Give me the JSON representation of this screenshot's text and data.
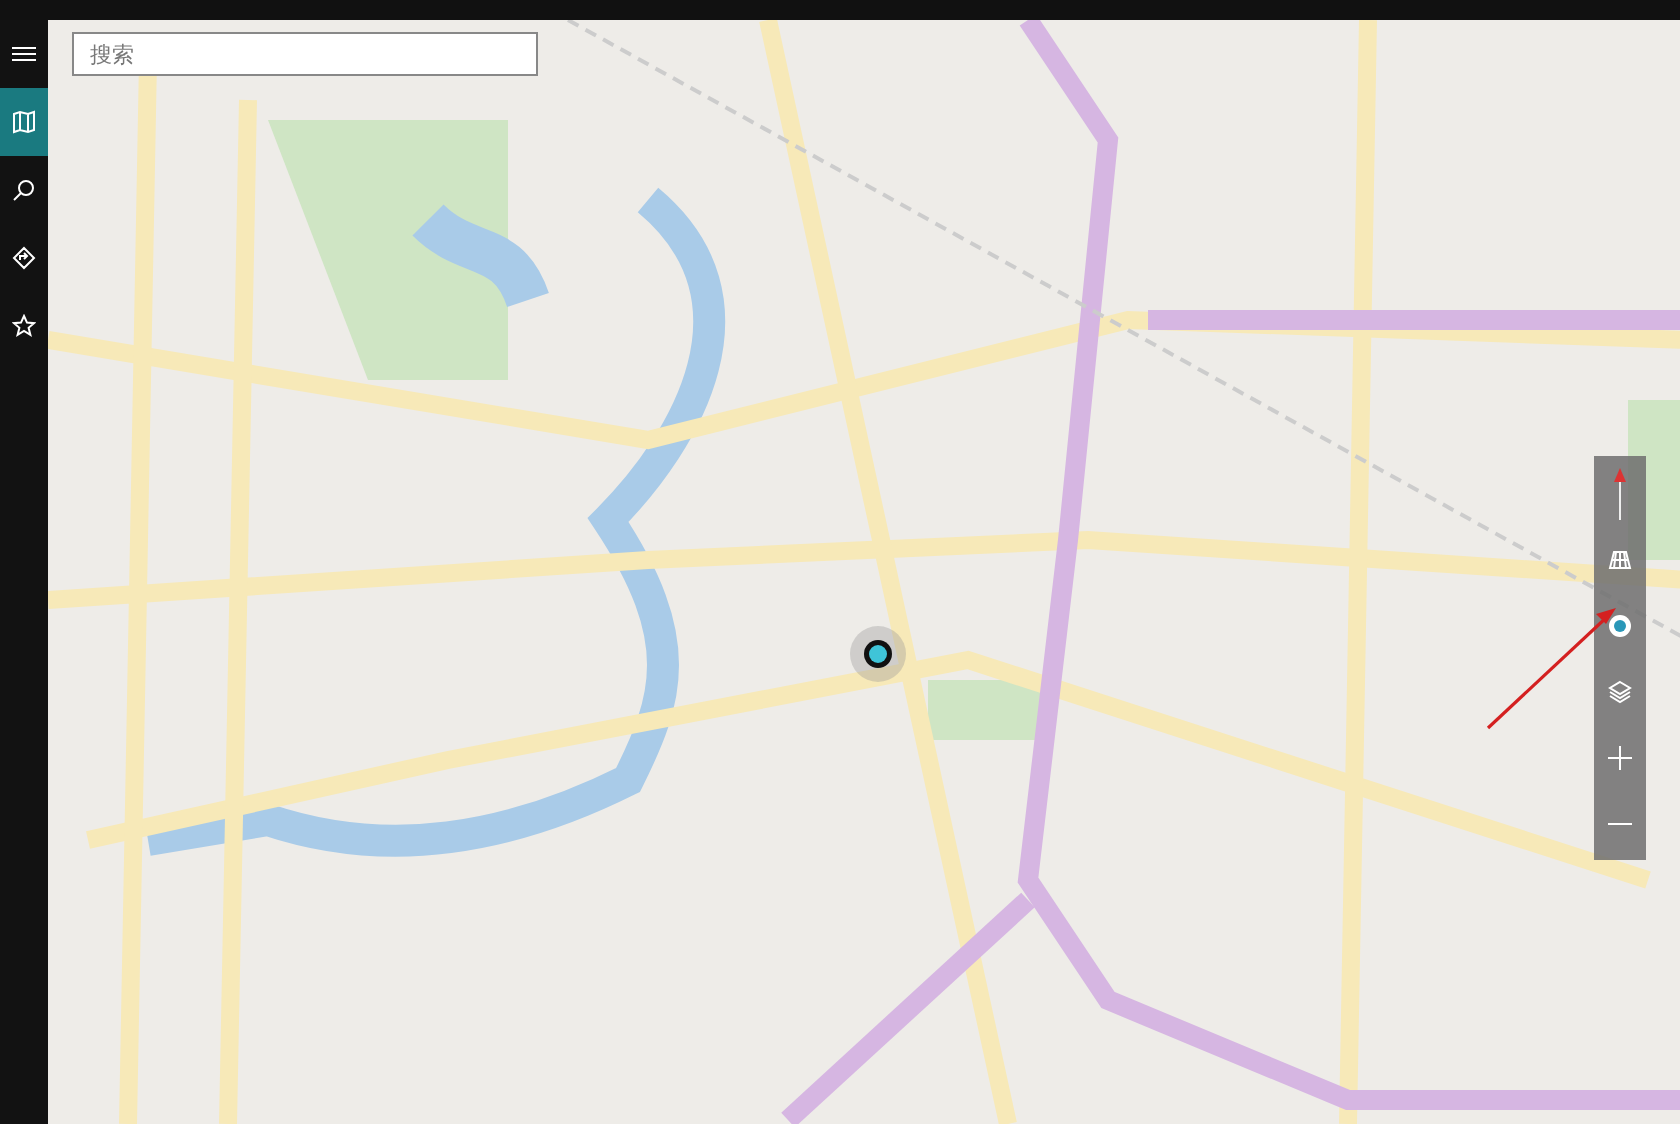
{
  "sidebar": {
    "items": [
      {
        "kind": "menu",
        "selected": false
      },
      {
        "kind": "map",
        "selected": true
      },
      {
        "kind": "search",
        "selected": false
      },
      {
        "kind": "directions",
        "selected": false
      },
      {
        "kind": "favorites",
        "selected": false
      }
    ]
  },
  "search": {
    "placeholder": "搜索"
  },
  "map_controls": [
    {
      "kind": "compass"
    },
    {
      "kind": "tilt"
    },
    {
      "kind": "locate"
    },
    {
      "kind": "layers"
    },
    {
      "kind": "zoom_in"
    },
    {
      "kind": "zoom_out"
    }
  ]
}
